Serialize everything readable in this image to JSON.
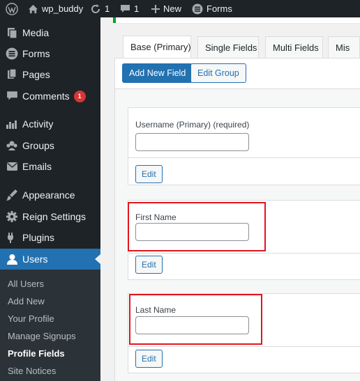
{
  "admin_bar": {
    "site_name": "wp_buddy",
    "updates_count": "1",
    "comments_count": "1",
    "new_label": "New",
    "forms_label": "Forms"
  },
  "sidebar": {
    "items": [
      {
        "label": "Media",
        "icon": "media-icon"
      },
      {
        "label": "Forms",
        "icon": "forms-icon"
      },
      {
        "label": "Pages",
        "icon": "pages-icon"
      },
      {
        "label": "Comments",
        "icon": "comments-icon",
        "badge": "1"
      },
      {
        "label": "Activity",
        "icon": "activity-icon"
      },
      {
        "label": "Groups",
        "icon": "groups-icon"
      },
      {
        "label": "Emails",
        "icon": "emails-icon"
      },
      {
        "label": "Appearance",
        "icon": "appearance-icon"
      },
      {
        "label": "Reign Settings",
        "icon": "gear-icon"
      },
      {
        "label": "Plugins",
        "icon": "plugins-icon"
      },
      {
        "label": "Users",
        "icon": "users-icon"
      }
    ],
    "submenu": [
      "All Users",
      "Add New",
      "Your Profile",
      "Manage Signups",
      "Profile Fields",
      "Site Notices"
    ],
    "current_submenu": "Profile Fields"
  },
  "tabs": [
    "Base (Primary)",
    "Single Fields",
    "Multi Fields",
    "Mis"
  ],
  "toolbar": {
    "add_field_label": "Add New Field",
    "edit_group_label": "Edit Group"
  },
  "fields": [
    {
      "label": "Username (Primary) (required)",
      "edit_label": "Edit",
      "highlighted": false
    },
    {
      "label": "First Name",
      "edit_label": "Edit",
      "highlighted": true
    },
    {
      "label": "Last Name",
      "edit_label": "Edit",
      "highlighted": true
    }
  ],
  "colors": {
    "admin_dark": "#1d2327",
    "accent_blue": "#2271b1",
    "highlight_red": "#e3141b",
    "badge_red": "#d63638",
    "notice_green": "#00a32a"
  }
}
